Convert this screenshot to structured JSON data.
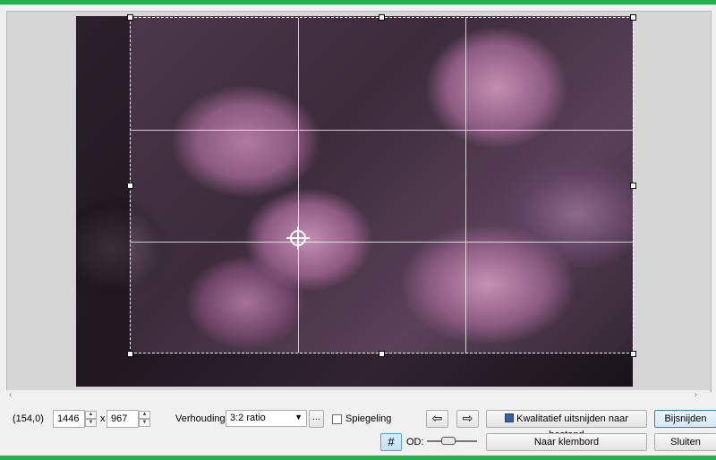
{
  "preview": {
    "image_subject": "purple curly kale leaves",
    "crop_ratio_label": "3:2 ratio"
  },
  "scroll": {
    "left_icon": "chevron-left-icon",
    "right_icon": "chevron-right-icon",
    "left_glyph": "‹",
    "right_glyph": "›"
  },
  "toolbar": {
    "coords": "(154,0)",
    "width_value": "1446",
    "times": "x",
    "height_value": "967",
    "ratio_label": "Verhouding:",
    "ratio_value": "3:2 ratio",
    "ratio_more": "...",
    "mirror_label": "Spiegeling",
    "prev_glyph": "⇦",
    "next_glyph": "⇨",
    "save_quality_label": "Kwalitatief uitsnijden naar bestand",
    "crop_label": "Bijsnijden",
    "grid_glyph": "#",
    "od_label": "OD:",
    "clipboard_label": "Naar klembord",
    "close_label": "Sluiten"
  },
  "colors": {
    "accent_green": "#22b24c",
    "primary_border": "#3c7fb1"
  }
}
